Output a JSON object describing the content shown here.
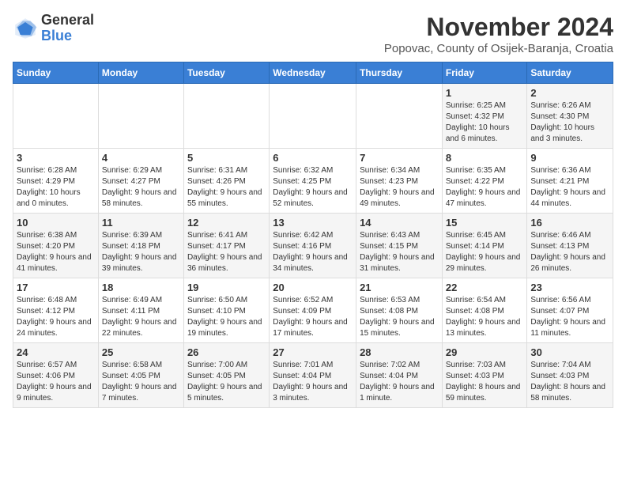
{
  "logo": {
    "general": "General",
    "blue": "Blue"
  },
  "title": "November 2024",
  "subtitle": "Popovac, County of Osijek-Baranja, Croatia",
  "days_of_week": [
    "Sunday",
    "Monday",
    "Tuesday",
    "Wednesday",
    "Thursday",
    "Friday",
    "Saturday"
  ],
  "weeks": [
    [
      {
        "day": "",
        "info": ""
      },
      {
        "day": "",
        "info": ""
      },
      {
        "day": "",
        "info": ""
      },
      {
        "day": "",
        "info": ""
      },
      {
        "day": "",
        "info": ""
      },
      {
        "day": "1",
        "info": "Sunrise: 6:25 AM\nSunset: 4:32 PM\nDaylight: 10 hours and 6 minutes."
      },
      {
        "day": "2",
        "info": "Sunrise: 6:26 AM\nSunset: 4:30 PM\nDaylight: 10 hours and 3 minutes."
      }
    ],
    [
      {
        "day": "3",
        "info": "Sunrise: 6:28 AM\nSunset: 4:29 PM\nDaylight: 10 hours and 0 minutes."
      },
      {
        "day": "4",
        "info": "Sunrise: 6:29 AM\nSunset: 4:27 PM\nDaylight: 9 hours and 58 minutes."
      },
      {
        "day": "5",
        "info": "Sunrise: 6:31 AM\nSunset: 4:26 PM\nDaylight: 9 hours and 55 minutes."
      },
      {
        "day": "6",
        "info": "Sunrise: 6:32 AM\nSunset: 4:25 PM\nDaylight: 9 hours and 52 minutes."
      },
      {
        "day": "7",
        "info": "Sunrise: 6:34 AM\nSunset: 4:23 PM\nDaylight: 9 hours and 49 minutes."
      },
      {
        "day": "8",
        "info": "Sunrise: 6:35 AM\nSunset: 4:22 PM\nDaylight: 9 hours and 47 minutes."
      },
      {
        "day": "9",
        "info": "Sunrise: 6:36 AM\nSunset: 4:21 PM\nDaylight: 9 hours and 44 minutes."
      }
    ],
    [
      {
        "day": "10",
        "info": "Sunrise: 6:38 AM\nSunset: 4:20 PM\nDaylight: 9 hours and 41 minutes."
      },
      {
        "day": "11",
        "info": "Sunrise: 6:39 AM\nSunset: 4:18 PM\nDaylight: 9 hours and 39 minutes."
      },
      {
        "day": "12",
        "info": "Sunrise: 6:41 AM\nSunset: 4:17 PM\nDaylight: 9 hours and 36 minutes."
      },
      {
        "day": "13",
        "info": "Sunrise: 6:42 AM\nSunset: 4:16 PM\nDaylight: 9 hours and 34 minutes."
      },
      {
        "day": "14",
        "info": "Sunrise: 6:43 AM\nSunset: 4:15 PM\nDaylight: 9 hours and 31 minutes."
      },
      {
        "day": "15",
        "info": "Sunrise: 6:45 AM\nSunset: 4:14 PM\nDaylight: 9 hours and 29 minutes."
      },
      {
        "day": "16",
        "info": "Sunrise: 6:46 AM\nSunset: 4:13 PM\nDaylight: 9 hours and 26 minutes."
      }
    ],
    [
      {
        "day": "17",
        "info": "Sunrise: 6:48 AM\nSunset: 4:12 PM\nDaylight: 9 hours and 24 minutes."
      },
      {
        "day": "18",
        "info": "Sunrise: 6:49 AM\nSunset: 4:11 PM\nDaylight: 9 hours and 22 minutes."
      },
      {
        "day": "19",
        "info": "Sunrise: 6:50 AM\nSunset: 4:10 PM\nDaylight: 9 hours and 19 minutes."
      },
      {
        "day": "20",
        "info": "Sunrise: 6:52 AM\nSunset: 4:09 PM\nDaylight: 9 hours and 17 minutes."
      },
      {
        "day": "21",
        "info": "Sunrise: 6:53 AM\nSunset: 4:08 PM\nDaylight: 9 hours and 15 minutes."
      },
      {
        "day": "22",
        "info": "Sunrise: 6:54 AM\nSunset: 4:08 PM\nDaylight: 9 hours and 13 minutes."
      },
      {
        "day": "23",
        "info": "Sunrise: 6:56 AM\nSunset: 4:07 PM\nDaylight: 9 hours and 11 minutes."
      }
    ],
    [
      {
        "day": "24",
        "info": "Sunrise: 6:57 AM\nSunset: 4:06 PM\nDaylight: 9 hours and 9 minutes."
      },
      {
        "day": "25",
        "info": "Sunrise: 6:58 AM\nSunset: 4:05 PM\nDaylight: 9 hours and 7 minutes."
      },
      {
        "day": "26",
        "info": "Sunrise: 7:00 AM\nSunset: 4:05 PM\nDaylight: 9 hours and 5 minutes."
      },
      {
        "day": "27",
        "info": "Sunrise: 7:01 AM\nSunset: 4:04 PM\nDaylight: 9 hours and 3 minutes."
      },
      {
        "day": "28",
        "info": "Sunrise: 7:02 AM\nSunset: 4:04 PM\nDaylight: 9 hours and 1 minute."
      },
      {
        "day": "29",
        "info": "Sunrise: 7:03 AM\nSunset: 4:03 PM\nDaylight: 8 hours and 59 minutes."
      },
      {
        "day": "30",
        "info": "Sunrise: 7:04 AM\nSunset: 4:03 PM\nDaylight: 8 hours and 58 minutes."
      }
    ]
  ]
}
